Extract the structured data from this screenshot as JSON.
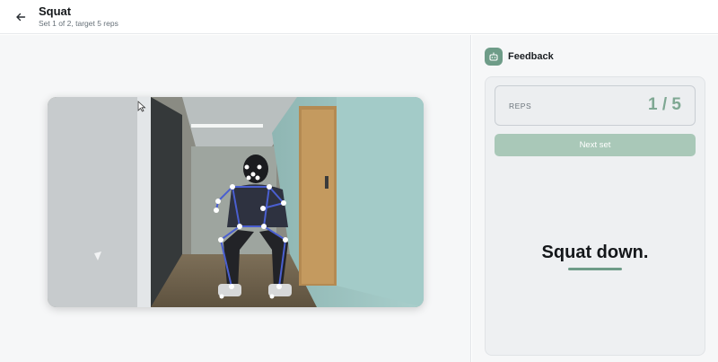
{
  "header": {
    "title": "Squat",
    "subtitle": "Set 1 of 2, target 5 reps",
    "back_icon": "arrow-left-icon"
  },
  "video": {
    "content": "webcam feed with pose skeleton overlay"
  },
  "feedback": {
    "title": "Feedback",
    "icon": "robot-icon",
    "reps_label": "REPS",
    "reps_value": "1 / 5",
    "next_button_label": "Next set",
    "cue": "Squat down."
  },
  "colors": {
    "accent": "#6e9c88",
    "accent_light": "#a9c8b8",
    "skeleton": "#4a5fd0",
    "joint": "#ffffff"
  }
}
